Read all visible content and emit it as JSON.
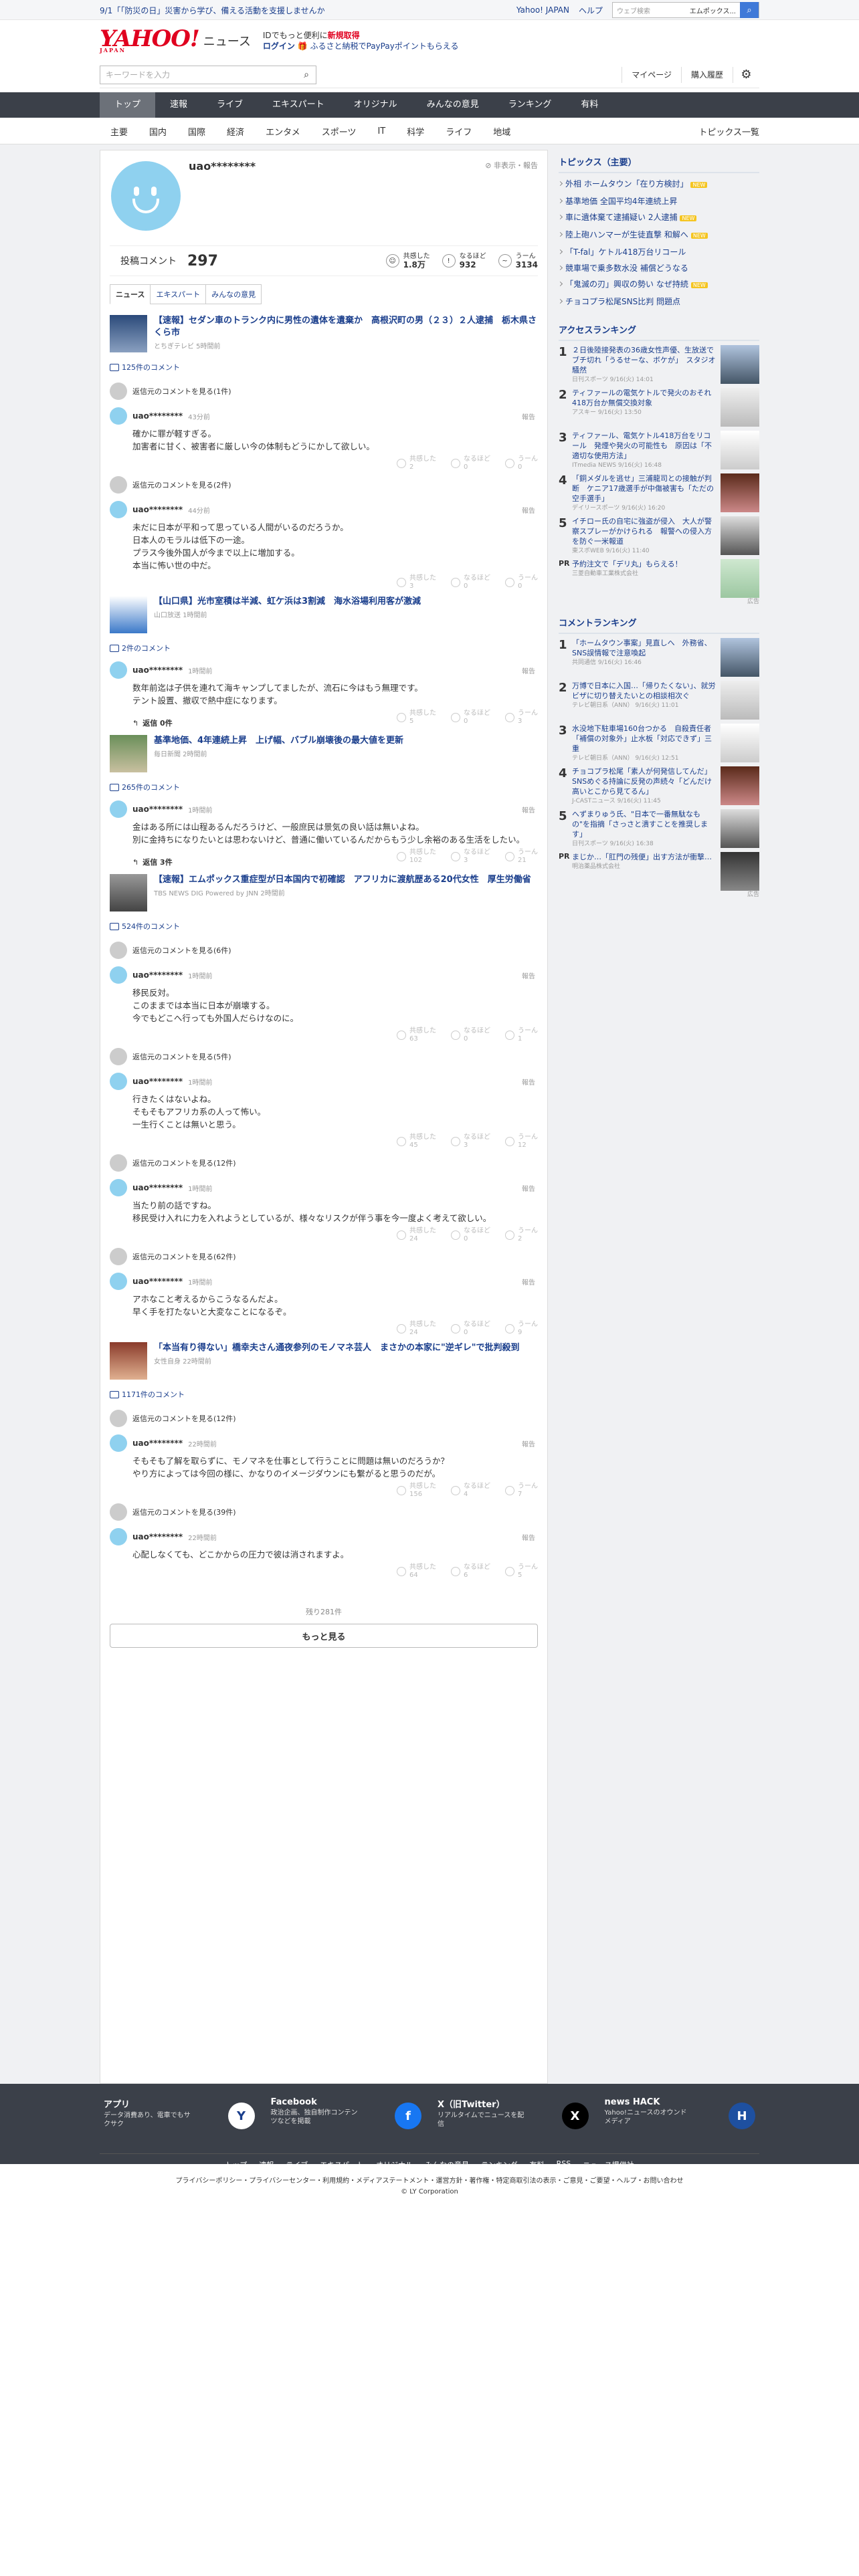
{
  "emergency": {
    "date": "9/1",
    "text": "「防災の日」災害から学び、備える活動を支援しませんか"
  },
  "topright": {
    "yj": "Yahoo! JAPAN",
    "help": "ヘルプ",
    "search_ph": "ウェブ検索",
    "search_val": "エムポックス..."
  },
  "header": {
    "logo": "YAHOO!",
    "logo_sub": "JAPAN",
    "site": "ニュース",
    "promo1_pre": "IDでもっと便利に",
    "promo1_b": "新規取得",
    "promo2_login": "ログイン",
    "promo2_text": "ふるさと納税でPayPayポイントもらえる"
  },
  "bar2": {
    "kw_ph": "キーワードを入力",
    "mypage": "マイページ",
    "history": "購入履歴"
  },
  "gnav": [
    "トップ",
    "速報",
    "ライブ",
    "エキスパート",
    "オリジナル",
    "みんなの意見",
    "ランキング",
    "有料"
  ],
  "snav": {
    "items": [
      "主要",
      "国内",
      "国際",
      "経済",
      "エンタメ",
      "スポーツ",
      "IT",
      "科学",
      "ライフ",
      "地域"
    ],
    "all": "トピックス一覧"
  },
  "profile": {
    "name": "uao********",
    "hide": "非表示・報告",
    "comments_label": "投稿コメント",
    "comments": "297",
    "empathy_label": "共感した",
    "empathy": "1.8万",
    "naruhodo_label": "なるほど",
    "naruhodo": "932",
    "uun_label": "うーん",
    "uun": "3134"
  },
  "tabs": [
    "ニュース",
    "エキスパート",
    "みんなの意見"
  ],
  "labels": {
    "parent": "返信元のコメントを見る",
    "report": "報告",
    "emp": "共感した",
    "nar": "なるほど",
    "uun": "うーん",
    "reply": "返信"
  },
  "articles": [
    {
      "title": "【速報】セダン車のトランク内に男性の遺体を遺棄か　高根沢町の男（２３）２人逮捕　栃木県さくら市",
      "src": "とちぎテレビ 5時間前",
      "ccount": "125件のコメント",
      "comments": [
        {
          "parent": "返信元のコメントを見る(1件)",
          "name": "uao********",
          "time": "43分前",
          "body": "確かに罪が軽すぎる。\n加害者に甘く、被害者に厳しい今の体制もどうにかして欲しい。",
          "e": "2",
          "n": "0",
          "u": "0"
        },
        {
          "parent": "返信元のコメントを見る(2件)",
          "name": "uao********",
          "time": "44分前",
          "body": "未だに日本が平和って思っている人間がいるのだろうか。\n日本人のモラルは低下の一途。\nプラス今後外国人が今まで以上に増加する。\n本当に怖い世の中だ。",
          "e": "3",
          "n": "0",
          "u": "0"
        }
      ]
    },
    {
      "title": "【山口県】光市室積は半減、虹ケ浜は3割減　海水浴場利用客が激減",
      "src": "山口放送 1時間前",
      "ccount": "2件のコメント",
      "comments": [
        {
          "parent": "",
          "name": "uao********",
          "time": "1時間前",
          "body": "数年前迄は子供を連れて海キャンプしてましたが、流石に今はもう無理です。\nテント設置、撤収で熱中症になります。",
          "e": "5",
          "n": "0",
          "u": "3",
          "reply": "返信 0件"
        }
      ]
    },
    {
      "title": "基準地価、4年連続上昇　上げ幅、バブル崩壊後の最大値を更新",
      "src": "毎日新聞 2時間前",
      "ccount": "265件のコメント",
      "comments": [
        {
          "parent": "",
          "name": "uao********",
          "time": "1時間前",
          "body": "金はある所には山程あるんだろうけど、一般庶民は景気の良い話は無いよね。\n別に金持ちになりたいとは思わないけど、普通に働いているんだからもう少し余裕のある生活をしたい。",
          "e": "102",
          "n": "3",
          "u": "21",
          "reply": "返信 3件"
        }
      ]
    },
    {
      "title": "【速報】エムポックス重症型が日本国内で初確認　アフリカに渡航歴ある20代女性　厚生労働省",
      "src": "TBS NEWS DIG Powered by JNN 2時間前",
      "ccount": "524件のコメント",
      "comments": [
        {
          "parent": "返信元のコメントを見る(6件)",
          "name": "uao********",
          "time": "1時間前",
          "body": "移民反対。\nこのままでは本当に日本が崩壊する。\n今でもどこへ行っても外国人だらけなのに。",
          "e": "63",
          "n": "0",
          "u": "1"
        },
        {
          "parent": "返信元のコメントを見る(5件)",
          "name": "uao********",
          "time": "1時間前",
          "body": "行きたくはないよね。\nそもそもアフリカ系の人って怖い。\n一生行くことは無いと思う。",
          "e": "45",
          "n": "3",
          "u": "12"
        },
        {
          "parent": "返信元のコメントを見る(12件)",
          "name": "uao********",
          "time": "1時間前",
          "body": "当たり前の話ですね。\n移民受け入れに力を入れようとしているが、様々なリスクが伴う事を今一度よく考えて欲しい。",
          "e": "24",
          "n": "0",
          "u": "2"
        },
        {
          "parent": "返信元のコメントを見る(62件)",
          "name": "uao********",
          "time": "1時間前",
          "body": "アホなこと考えるからこうなるんだよ。\n早く手を打たないと大変なことになるぞ。",
          "e": "24",
          "n": "0",
          "u": "9"
        }
      ]
    },
    {
      "title": "「本当有り得ない」橋幸夫さん通夜参列のモノマネ芸人　まさかの本家に\"逆ギレ\"で批判殺到",
      "src": "女性自身 22時間前",
      "ccount": "1171件のコメント",
      "comments": [
        {
          "parent": "返信元のコメントを見る(12件)",
          "name": "uao********",
          "time": "22時間前",
          "body": "そもそも了解を取らずに、モノマネを仕事として行うことに問題は無いのだろうか？\nやり方によっては今回の様に、かなりのイメージダウンにも繋がると思うのだが。",
          "e": "156",
          "n": "4",
          "u": "7"
        },
        {
          "parent": "返信元のコメントを見る(39件)",
          "name": "uao********",
          "time": "22時間前",
          "body": "心配しなくても、どこかからの圧力で彼は消されますよ。",
          "e": "64",
          "n": "6",
          "u": "5"
        }
      ]
    }
  ],
  "more": {
    "remain": "残り281件",
    "btn": "もっと見る"
  },
  "side": {
    "topics_h": "トピックス（主要）",
    "topics": [
      {
        "t": "外相 ホームタウン「在り方検討」",
        "new": "NEW"
      },
      {
        "t": "基準地価 全国平均4年連続上昇",
        "new": ""
      },
      {
        "t": "車に遺体棄て逮捕疑い 2人逮捕",
        "new": "NEW"
      },
      {
        "t": "陸上砲ハンマーが生徒直撃 和解へ",
        "new": "NEW"
      },
      {
        "t": "「T-fal」ケトル418万台リコール",
        "new": ""
      },
      {
        "t": "競車場で乗多数水没 補償どうなる",
        "new": ""
      },
      {
        "t": "「鬼滅の刃」興収の勢い なぜ持続",
        "new": "NEW"
      },
      {
        "t": "チョコプラ松尾SNS比判 問題点",
        "new": ""
      }
    ],
    "access_h": "アクセスランキング",
    "access": [
      {
        "n": "1",
        "t": "２日後陸接発表の36歳女性声優、生放送でブチ切れ「うるせーな、ボケが」　スタジオ騒然",
        "m": "日刊スポーツ 9/16(火) 14:01"
      },
      {
        "n": "2",
        "t": "ティファールの電気ケトルで発火のおそれ　418万台か無償交換対象",
        "m": "アスキー 9/16(火) 13:50"
      },
      {
        "n": "3",
        "t": "ティファール、電気ケトル418万台をリコール　発煙や発火の可能性も　原因は「不適切な使用方法」",
        "m": "ITmedia NEWS 9/16(火) 16:48"
      },
      {
        "n": "4",
        "t": "「銅メダルを逃せ」三浦龍司との接触が判断　ケニア17歳選手が中傷被害も「ただの空手選手」",
        "m": "デイリースポーツ 9/16(火) 16:20"
      },
      {
        "n": "5",
        "t": "イチロー氏の自宅に強盗が侵入　大人が警察スプレーがかけられる　報警への侵入方を防ぐ一米報道",
        "m": "東スポWEB 9/16(火) 11:40"
      }
    ],
    "pr1": {
      "t": "予約注文で「デリ丸」もらえる！",
      "m": "三菱自動車工業株式会社",
      "ad": "広告"
    },
    "comment_h": "コメントランキング",
    "crank": [
      {
        "n": "1",
        "t": "「ホームタウン事案」見直しへ　外務省、SNS誤情報で注意喚起",
        "m": "共同通信 9/16(火) 16:46"
      },
      {
        "n": "2",
        "t": "万博で日本に入国…「帰りたくない」、就労ビザに切り替えたいとの相談相次ぐ",
        "m": "テレビ朝日系（ANN） 9/16(火) 11:01"
      },
      {
        "n": "3",
        "t": "水没地下駐車場160台つかる　自殺責任者「補償の対象外」止水板「対応できず」三重",
        "m": "テレビ朝日系（ANN） 9/16(火) 12:51"
      },
      {
        "n": "4",
        "t": "チョコプラ松尾「素人が何発信してんだ」　SNSめぐる持論に反発の声続々「どんだけ高いとこから見てるん」",
        "m": "J-CASTニュース 9/16(火) 11:45"
      },
      {
        "n": "5",
        "t": "へずまりゅう氏、\"日本で一番無駄なもの\"を指摘「さっさと潰すことを推奨します」",
        "m": "日刊スポーツ 9/16(火) 16:38"
      }
    ],
    "pr2": {
      "t": "まじか…「肛門の残便」出す方法が衝撃…",
      "m": "明治薬品株式会社",
      "ad": "広告"
    }
  },
  "footer": {
    "blocks": [
      {
        "ti": "アプリ",
        "dd": "データ消費あり、電車でもサクサク",
        "ico": "Y"
      },
      {
        "ti": "Facebook",
        "dd": "政治企画、独自制作コンテンツなどを掲載",
        "ico": "f"
      },
      {
        "ti": "X（旧Twitter）",
        "dd": "リアルタイムでニュースを配信",
        "ico": "X"
      },
      {
        "ti": "news HACK",
        "dd": "Yahoo!ニュースのオウンドメディア",
        "ico": "H"
      }
    ],
    "links": [
      "トップ",
      "速報",
      "ライブ",
      "エキスパート",
      "オリジナル",
      "みんなの意見",
      "ランキング",
      "有料",
      "RSS",
      "ニュース提供社"
    ],
    "legal": "プライバシーポリシー・プライバシーセンター・利用規約・メディアステートメント・運営方針・著作権・特定商取引法の表示・ご意見・ご要望・ヘルプ・お問い合わせ",
    "copy": "© LY Corporation"
  },
  "colors": {
    "brand": "#e0001f",
    "link": "#1a3e8c",
    "nav": "#3b4049"
  }
}
